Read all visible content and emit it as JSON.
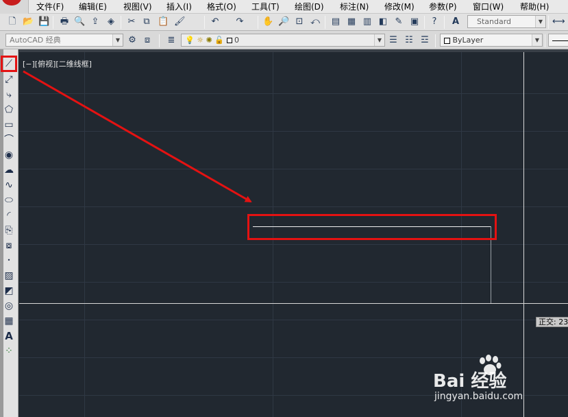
{
  "menubar": {
    "items": [
      "文件(F)",
      "编辑(E)",
      "视图(V)",
      "插入(I)",
      "格式(O)",
      "工具(T)",
      "绘图(D)",
      "标注(N)",
      "修改(M)",
      "参数(P)",
      "窗口(W)",
      "帮助(H)"
    ]
  },
  "toolbar": {
    "text_style": "Standard",
    "icons": [
      "new-file-icon",
      "open-file-icon",
      "save-icon",
      "plot-icon",
      "plot-preview-icon",
      "publish-icon",
      "3d-dwf-icon",
      "cut-icon",
      "copy-icon",
      "paste-icon",
      "match-properties-icon",
      "undo-icon",
      "redo-icon",
      "pan-icon",
      "zoom-realtime-icon",
      "zoom-window-icon",
      "zoom-previous-icon",
      "properties-icon",
      "design-center-icon",
      "tool-palettes-icon",
      "sheet-set-icon",
      "calculator-icon",
      "help-icon",
      "text-style-icon",
      "dim-style-icon"
    ]
  },
  "workspace": {
    "name": "AutoCAD 经典",
    "layer": "0",
    "color": "ByLayer"
  },
  "palette": {
    "icons": [
      "line-icon",
      "construction-line-icon",
      "polyline-icon",
      "polygon-icon",
      "rectangle-icon",
      "arc-icon",
      "circle-icon",
      "revision-cloud-icon",
      "spline-icon",
      "ellipse-icon",
      "ellipse-arc-icon",
      "insert-block-icon",
      "make-block-icon",
      "point-icon",
      "hatch-icon",
      "gradient-icon",
      "region-icon",
      "table-icon",
      "multiline-text-icon",
      "add-selected-icon"
    ],
    "highlighted": "line-icon"
  },
  "viewport": {
    "label": "[−][俯视][二维线框]"
  },
  "tooltip": {
    "text": "正交: 23"
  },
  "watermark": {
    "brand": "Bai 经验",
    "url": "jingyan.baidu.com"
  },
  "colors": {
    "canvas": "#212830",
    "annotation": "#e41212",
    "drawn_line": "#f0f0f0"
  }
}
